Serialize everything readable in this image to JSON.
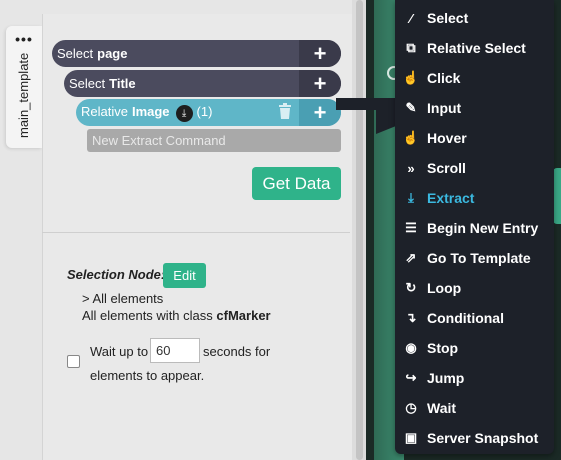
{
  "tab": {
    "dots": "•••",
    "label": "main_template"
  },
  "nodes": {
    "page": {
      "prefix": "Select",
      "name": "page"
    },
    "title": {
      "prefix": "Select",
      "name": "Title"
    },
    "image": {
      "prefix": "Relative",
      "name": "Image",
      "count": "(1)"
    },
    "plus": "+"
  },
  "new_command_placeholder": "New Extract Command",
  "get_data_label": "Get Data",
  "selection": {
    "label": "Selection Node:",
    "edit_label": "Edit",
    "line1": "> All elements",
    "line2_prefix": "All elements with class",
    "line2_class": "cfMarker"
  },
  "wait": {
    "pre": "Wait up to",
    "value": "60",
    "post": "seconds for",
    "line2": "elements to appear."
  },
  "menu": {
    "items": [
      {
        "label": "Select",
        "icon": "magic-wand-icon",
        "glyph": "⁄"
      },
      {
        "label": "Relative Select",
        "icon": "relative-select-icon",
        "glyph": "⧉"
      },
      {
        "label": "Click",
        "icon": "pointer-hand-icon",
        "glyph": "☝"
      },
      {
        "label": "Input",
        "icon": "pencil-icon",
        "glyph": "✎"
      },
      {
        "label": "Hover",
        "icon": "hover-hand-icon",
        "glyph": "☝"
      },
      {
        "label": "Scroll",
        "icon": "scroll-icon",
        "glyph": "»"
      },
      {
        "label": "Extract",
        "icon": "download-icon",
        "glyph": "⤓",
        "active": true
      },
      {
        "label": "Begin New Entry",
        "icon": "list-icon",
        "glyph": "☰"
      },
      {
        "label": "Go To Template",
        "icon": "external-link-icon",
        "glyph": "⇗"
      },
      {
        "label": "Loop",
        "icon": "loop-icon",
        "glyph": "↻"
      },
      {
        "label": "Conditional",
        "icon": "conditional-icon",
        "glyph": "↴"
      },
      {
        "label": "Stop",
        "icon": "stop-icon",
        "glyph": "◉"
      },
      {
        "label": "Jump",
        "icon": "jump-icon",
        "glyph": "↪"
      },
      {
        "label": "Wait",
        "icon": "clock-icon",
        "glyph": "◷"
      },
      {
        "label": "Server Snapshot",
        "icon": "camera-icon",
        "glyph": "▣"
      }
    ]
  },
  "colors": {
    "accent_green": "#2fb38a",
    "node_dark": "#4b4b5e",
    "node_relative": "#5fb6c8",
    "menu_bg": "#1d2129",
    "menu_active": "#3bb9e0"
  }
}
